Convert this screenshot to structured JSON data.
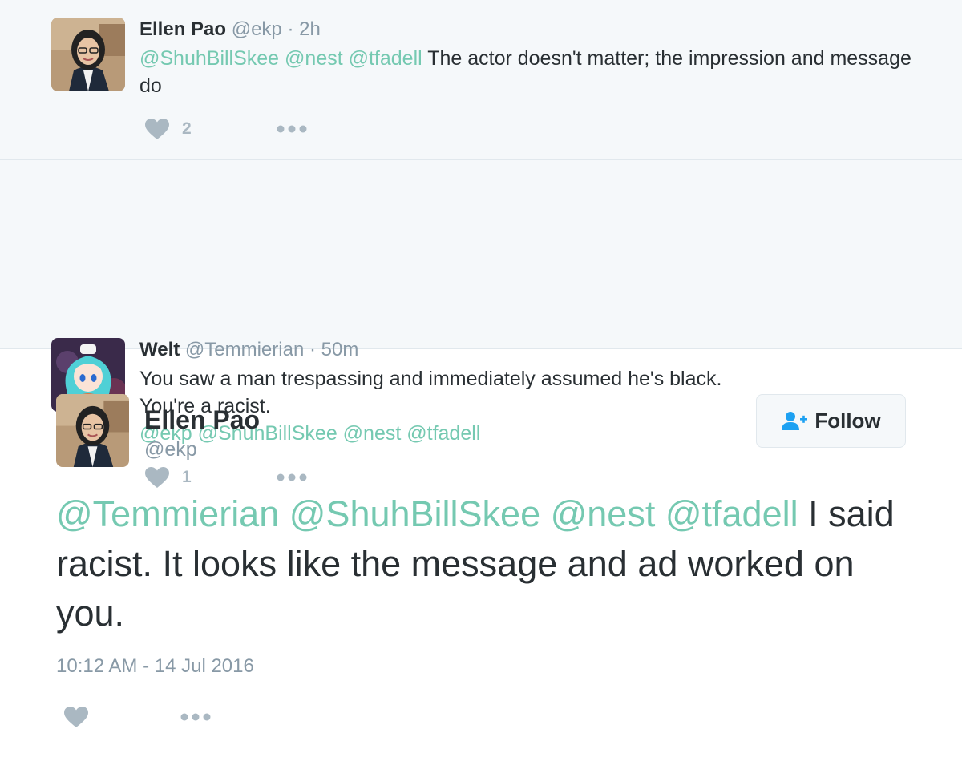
{
  "replies": [
    {
      "name": "Ellen Pao",
      "handle": "@ekp",
      "time": "2h",
      "text_mentions": "@ShuhBillSkee @nest @tfadell",
      "text": "The actor doesn't matter; the impression and message do",
      "like_count": "2"
    },
    {
      "name": "Welt",
      "handle": "@Temmierian",
      "time": "50m",
      "text_line1": "You saw a man trespassing and immediately assumed he's black.",
      "text_line2": "You're a racist.",
      "text_mentions": "@ekp @ShuhBillSkee @nest @tfadell",
      "like_count": "1"
    }
  ],
  "main_tweet": {
    "name": "Ellen Pao",
    "handle": "@ekp",
    "follow_label": "Follow",
    "text_mentions": "@Temmierian @ShuhBillSkee @nest @tfadell",
    "text": "I said racist. It looks like the message and ad worked on you.",
    "timestamp": "10:12 AM - 14 Jul 2016"
  },
  "separator": "·",
  "icons": {
    "like": "heart-icon",
    "more": "more-dots-icon",
    "follow": "add-person-icon"
  },
  "colors": {
    "mention": "#75c9b1",
    "muted": "#8899a6",
    "icon": "#aab8c2",
    "reply_bg": "#f5f8fa",
    "follow_icon": "#1da1f2"
  }
}
